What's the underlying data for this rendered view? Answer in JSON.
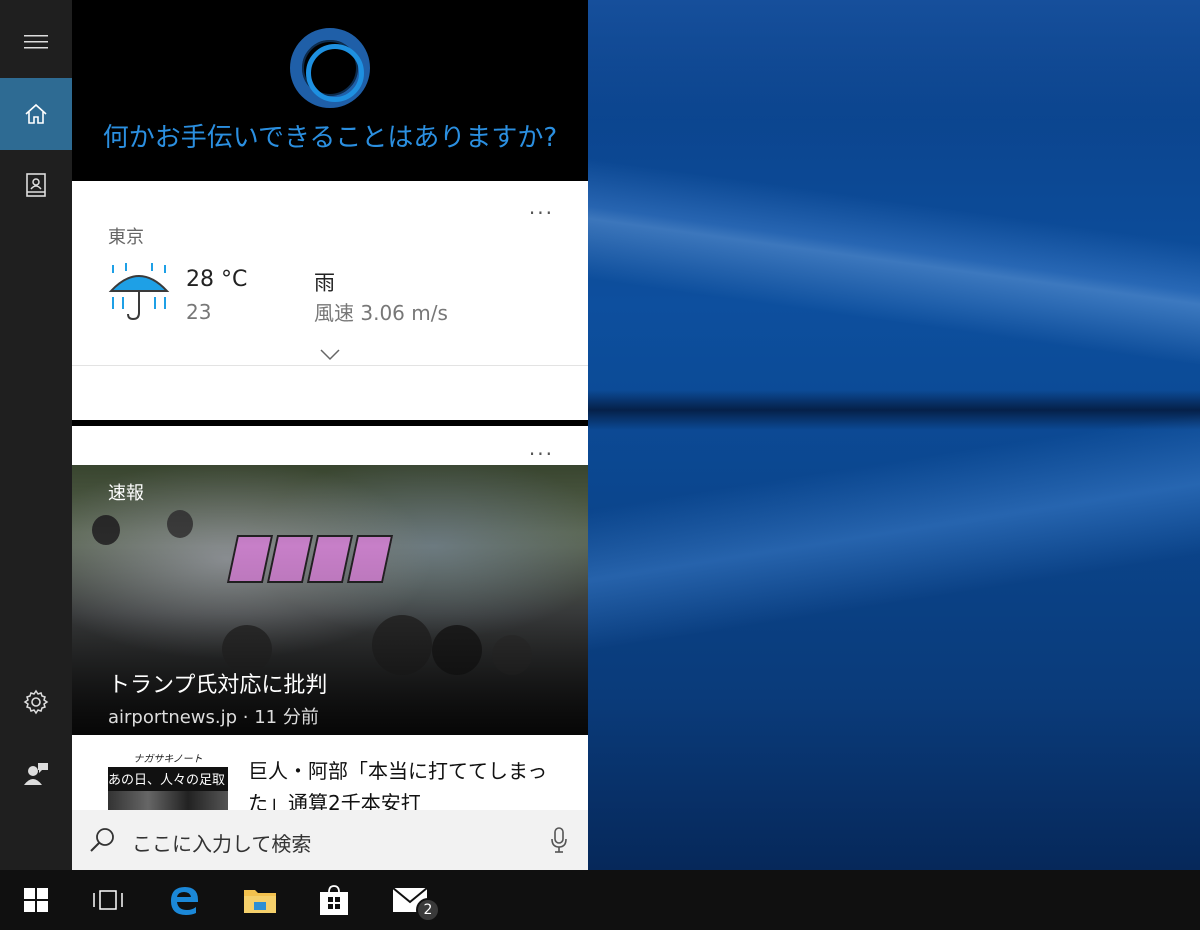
{
  "cortana": {
    "greeting": "何かお手伝いできることはありますか?"
  },
  "weather_card": {
    "menu_label": "...",
    "city": "東京",
    "temperature": "28 °C",
    "low": "23",
    "condition": "雨",
    "wind": "風速 3.06 m/s",
    "icon": "umbrella-rain-icon"
  },
  "news_card": {
    "menu_label": "...",
    "badge": "速報",
    "headline": "トランプ氏対応に批判",
    "source": "airportnews.jp · 11 分前",
    "story": {
      "thumb_header": "ナガサキノート",
      "thumb_text": "あの日、人々の足取",
      "title": "巨人・阿部「本当に打ててしまっ",
      "title_line2": "た」通算2千本安打"
    }
  },
  "search": {
    "placeholder": "ここに入力して検索"
  },
  "taskbar": {
    "mail_badge": "2"
  },
  "colors": {
    "accent": "#2b8fe0",
    "rail_active": "#2e6b93",
    "taskbar": "#101010"
  }
}
